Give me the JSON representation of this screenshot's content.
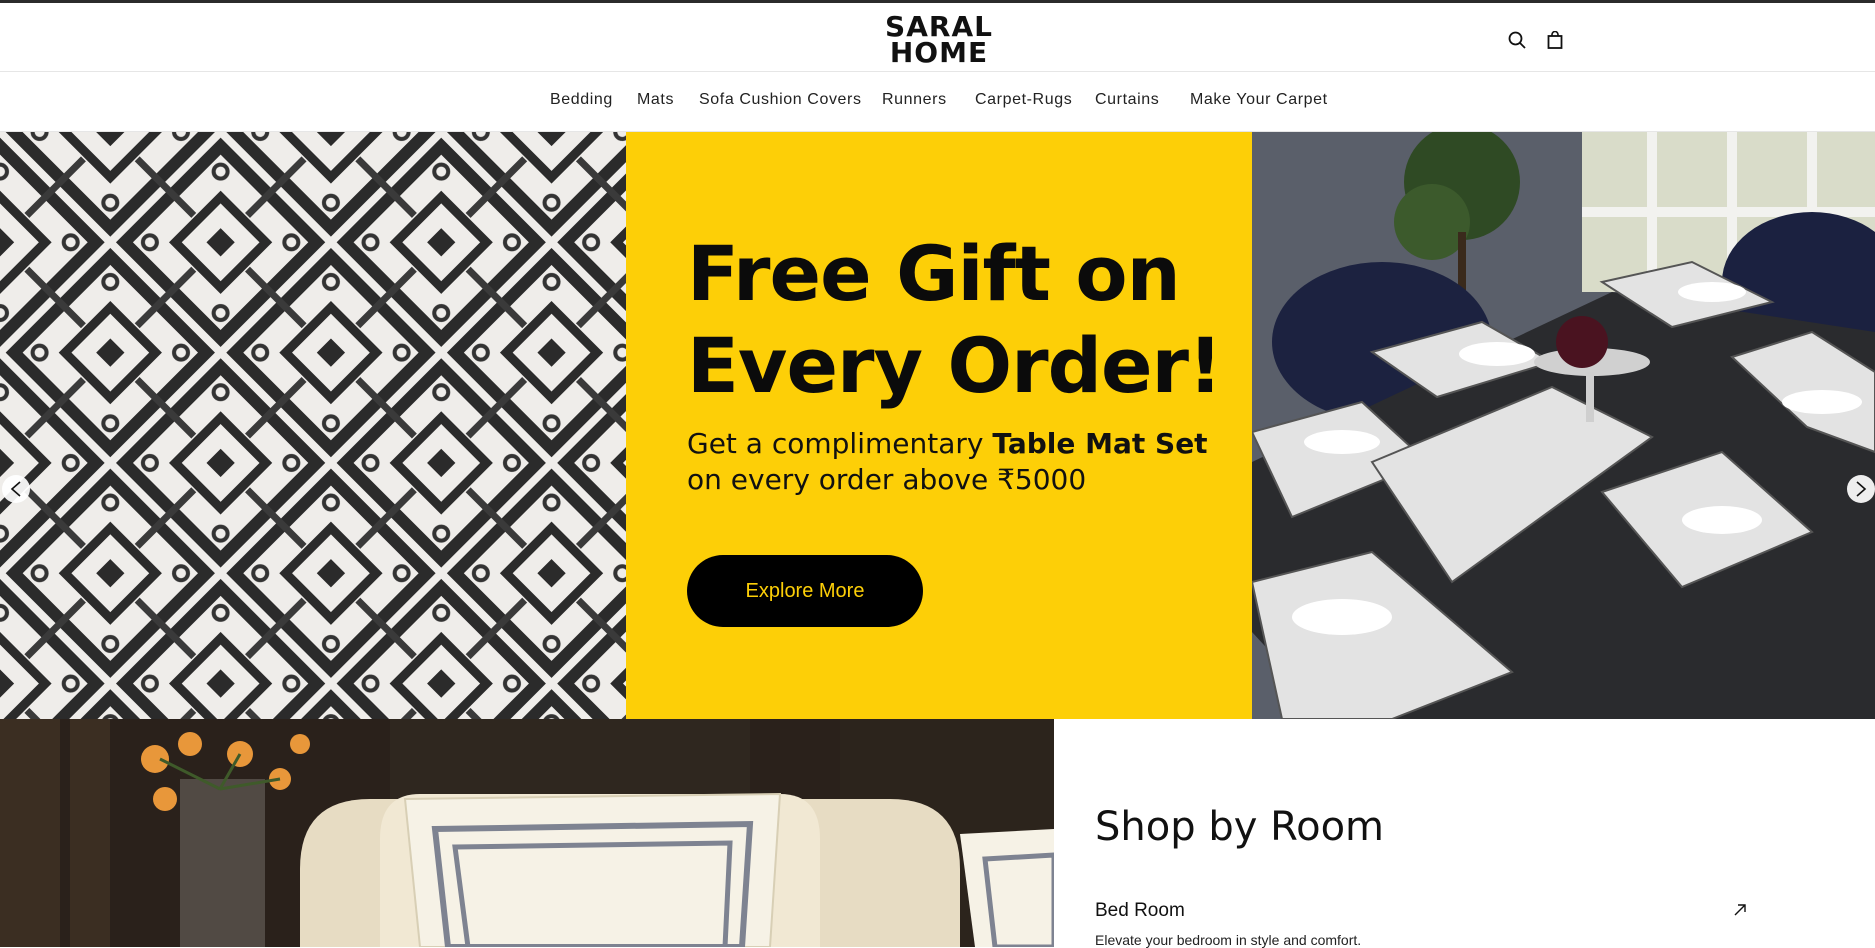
{
  "header": {
    "logo_line1": "SARAL",
    "logo_line2": "HOME",
    "search_icon": "search-icon",
    "cart_icon": "shopping-bag-icon"
  },
  "nav": {
    "items": [
      {
        "label": "Bedding"
      },
      {
        "label": "Mats"
      },
      {
        "label": "Sofa Cushion Covers"
      },
      {
        "label": "Runners"
      },
      {
        "label": "Carpet-Rugs"
      },
      {
        "label": "Curtains"
      },
      {
        "label": "Make Your Carpet"
      }
    ]
  },
  "hero": {
    "title_line1": "Free Gift on",
    "title_line2": "Every Order!",
    "sub_prefix": "Get a complimentary ",
    "sub_bold": "Table Mat Set",
    "sub_line2": "on every order above ₹5000",
    "cta_label": "Explore More",
    "accent_color": "#fdcf07",
    "prev_icon": "chevron-left-icon",
    "next_icon": "chevron-right-icon"
  },
  "shop_by_room": {
    "heading": "Shop by Room",
    "rooms": [
      {
        "name": "Bed Room",
        "description": "Elevate your bedroom in style and comfort.",
        "icon": "arrow-up-right-icon"
      }
    ]
  }
}
